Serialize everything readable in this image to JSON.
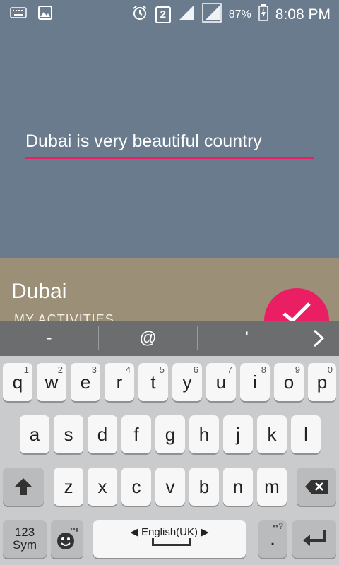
{
  "status_bar": {
    "sim_badge": "2",
    "battery_percent": "87%",
    "time": "8:08 PM",
    "icons": [
      "keyboard-icon",
      "image-icon",
      "alarm-icon",
      "signal-icon",
      "signal-icon",
      "battery-charging-icon"
    ]
  },
  "editor": {
    "text_value": "Dubai is very beautiful country",
    "accent": "#e91e63"
  },
  "card": {
    "title": "Dubai",
    "subtitle": "MY ACTIVITIES",
    "fab_icon": "check-icon"
  },
  "suggestions": {
    "items": [
      "-",
      "@",
      "'"
    ],
    "next_icon": "chevron-right-icon"
  },
  "keyboard": {
    "row1": [
      {
        "label": "q",
        "hint": "1"
      },
      {
        "label": "w",
        "hint": "2"
      },
      {
        "label": "e",
        "hint": "3"
      },
      {
        "label": "r",
        "hint": "4"
      },
      {
        "label": "t",
        "hint": "5"
      },
      {
        "label": "y",
        "hint": "6"
      },
      {
        "label": "u",
        "hint": "7"
      },
      {
        "label": "i",
        "hint": "8"
      },
      {
        "label": "o",
        "hint": "9"
      },
      {
        "label": "p",
        "hint": "0"
      }
    ],
    "row2": [
      "a",
      "s",
      "d",
      "f",
      "g",
      "h",
      "j",
      "k",
      "l"
    ],
    "row3": [
      "z",
      "x",
      "c",
      "v",
      "b",
      "n",
      "m"
    ],
    "sym_line1": "123",
    "sym_line2": "Sym",
    "language": "English(UK)",
    "period": "."
  }
}
